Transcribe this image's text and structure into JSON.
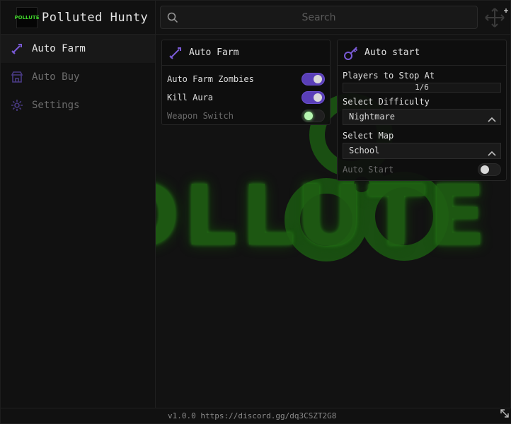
{
  "app": {
    "title": "Polluted Hunty",
    "logo_text": "POLLUTE",
    "version": "v1.0.0",
    "discord": "https://discord.gg/dq3CSZT2G8"
  },
  "search": {
    "placeholder": "Search",
    "value": ""
  },
  "sidebar": {
    "items": [
      {
        "label": "Auto Farm",
        "icon": "sword-icon",
        "active": true
      },
      {
        "label": "Auto Buy",
        "icon": "shop-icon",
        "active": false
      },
      {
        "label": "Settings",
        "icon": "gear-icon",
        "active": false
      }
    ]
  },
  "background": {
    "word": "POLLUTE"
  },
  "auto_farm": {
    "title": "Auto Farm",
    "toggles": [
      {
        "label": "Auto Farm Zombies",
        "on": true
      },
      {
        "label": "Kill Aura",
        "on": true
      },
      {
        "label": "Weapon Switch",
        "on": false
      }
    ]
  },
  "auto_start": {
    "title": "Auto start",
    "players_label": "Players to Stop At",
    "players_value": "1/6",
    "difficulty_label": "Select Difficulty",
    "difficulty_value": "Nightmare",
    "map_label": "Select Map",
    "map_value": "School",
    "auto_start_label": "Auto Start",
    "auto_start_on": false
  },
  "colors": {
    "accent": "#5a3fb8",
    "toxic_green": "#2b8a1a",
    "background": "#121212"
  }
}
